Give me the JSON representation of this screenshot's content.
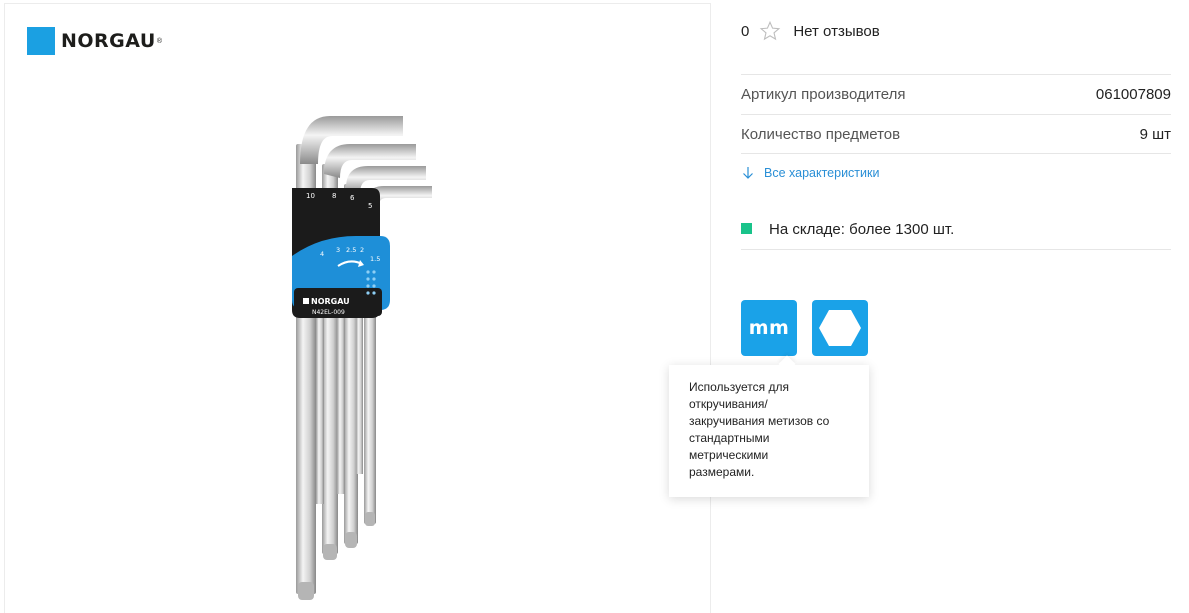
{
  "brand": {
    "name": "NORGAU",
    "registered": "®",
    "color": "#1ba0e2"
  },
  "product_image": {
    "description_icon": "hex-key-set-icon",
    "holder_sizes_top": [
      "10",
      "8",
      "6",
      "5"
    ],
    "holder_sizes_bottom": [
      "4",
      "3",
      "2.5",
      "2",
      "1.5"
    ],
    "holder_brand": "NORGAU",
    "holder_model": "N42EL-009"
  },
  "reviews": {
    "count": "0",
    "label": "Нет отзывов"
  },
  "specs": [
    {
      "label": "Артикул производителя",
      "value": "061007809"
    },
    {
      "label": "Количество предметов",
      "value": "9 шт"
    }
  ],
  "all_specs_link": "Все характеристики",
  "stock": {
    "text": "На складе: более 1300 шт.",
    "status_color": "#19c38a"
  },
  "badges": [
    {
      "icon": "mm-icon",
      "text": "mm"
    },
    {
      "icon": "hexagon-icon"
    }
  ],
  "tooltip": {
    "text": "Используется для\nоткручивания/\nзакручивания метизов со\nстандартными\nметрическими\nразмерами."
  },
  "colors": {
    "accent": "#1aa2e8",
    "link": "#2a8fd6",
    "stock": "#19c38a"
  }
}
